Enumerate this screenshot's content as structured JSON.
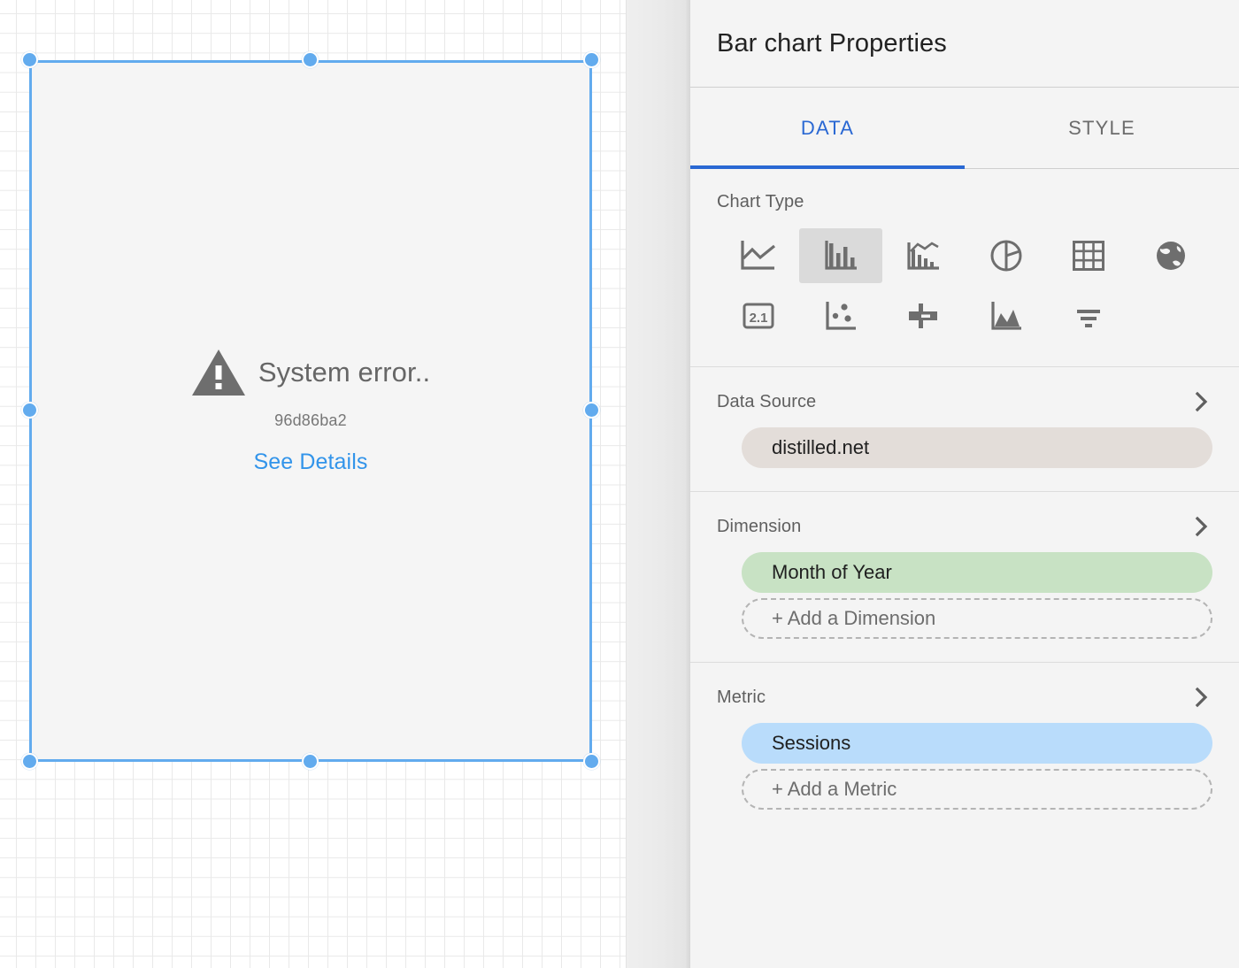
{
  "canvas": {
    "error": {
      "icon": "warning-triangle-icon",
      "title": "System error..",
      "code": "96d86ba2",
      "details_link": "See Details"
    }
  },
  "panel": {
    "title": "Bar chart Properties",
    "tabs": [
      {
        "id": "data",
        "label": "DATA",
        "active": true
      },
      {
        "id": "style",
        "label": "STYLE",
        "active": false
      }
    ],
    "chart_type": {
      "label": "Chart Type",
      "selected": "bar",
      "options": [
        {
          "id": "line",
          "icon": "line-chart-icon",
          "selected": false
        },
        {
          "id": "bar",
          "icon": "bar-chart-icon",
          "selected": true
        },
        {
          "id": "combo",
          "icon": "combo-chart-icon",
          "selected": false
        },
        {
          "id": "pie",
          "icon": "pie-chart-icon",
          "selected": false
        },
        {
          "id": "table",
          "icon": "table-icon",
          "selected": false
        },
        {
          "id": "geo",
          "icon": "globe-icon",
          "selected": false
        },
        {
          "id": "scorecard",
          "icon": "scorecard-icon",
          "selected": false
        },
        {
          "id": "scatter",
          "icon": "scatter-chart-icon",
          "selected": false
        },
        {
          "id": "bullet",
          "icon": "bullet-chart-icon",
          "selected": false
        },
        {
          "id": "area",
          "icon": "area-chart-icon",
          "selected": false
        },
        {
          "id": "funnel",
          "icon": "filter-funnel-icon",
          "selected": false
        }
      ],
      "scorecard_glyph": "2.1"
    },
    "data_source": {
      "label": "Data Source",
      "chips": [
        "distilled.net"
      ]
    },
    "dimension": {
      "label": "Dimension",
      "chips": [
        "Month of Year"
      ],
      "add_label": "+ Add a Dimension"
    },
    "metric": {
      "label": "Metric",
      "chips": [
        "Sessions"
      ],
      "add_label": "+ Add a Metric"
    }
  },
  "colors": {
    "accent_blue": "#2a68d3",
    "selection_blue": "#62abee",
    "link_blue": "#3294ea",
    "chip_source": "#e3ddd9",
    "chip_dimension": "#c8e2c4",
    "chip_metric": "#b9dcfb",
    "panel_bg": "#f4f4f4"
  }
}
